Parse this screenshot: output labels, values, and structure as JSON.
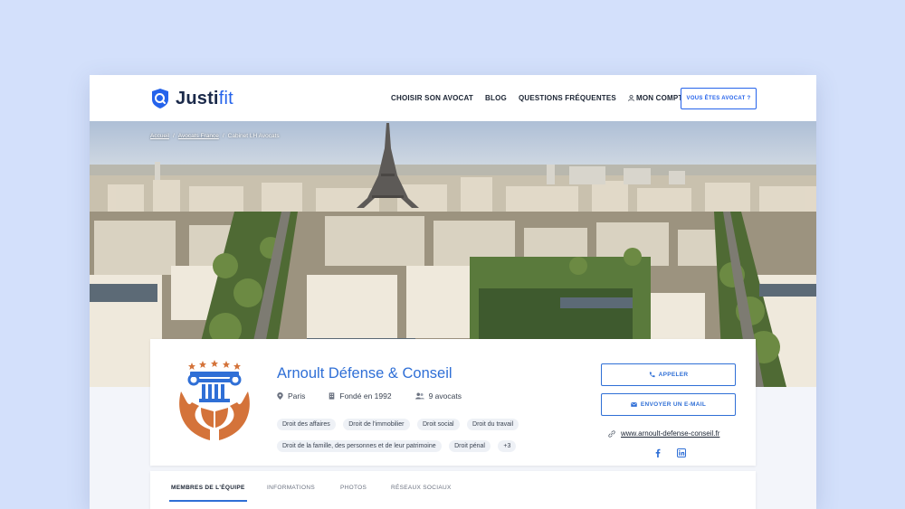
{
  "brand": {
    "name_dark": "Justi",
    "name_light": "fit"
  },
  "nav": {
    "items": [
      "CHOISIR SON AVOCAT",
      "BLOG",
      "QUESTIONS FRÉQUENTES",
      "MON COMPTE PRO"
    ],
    "cta": "VOUS ÊTES AVOCAT ?"
  },
  "breadcrumb": [
    "Accueil",
    "Avocats France",
    "Cabinet LH Avocats"
  ],
  "firm": {
    "name": "Arnoult Défense & Conseil",
    "city": "Paris",
    "founded": "Fondé en 1992",
    "lawyers": "9 avocats",
    "tags": [
      "Droit des affaires",
      "Droit de l'immobilier",
      "Droit social",
      "Droit du travail",
      "Droit de la famille, des personnes et de leur patrimoine",
      "Droit pénal",
      "+3"
    ],
    "call_label": "APPELER",
    "email_label": "ENVOYER UN E-MAIL",
    "website": "www.arnoult-defense-conseil.fr",
    "social": [
      "facebook-icon",
      "linkedin-icon"
    ]
  },
  "tabs": [
    "MEMBRES DE L'ÉQUIPE",
    "INFORMATIONS",
    "PHOTOS",
    "RÉSEAUX SOCIAUX"
  ],
  "colors": {
    "accent": "#2f6fd6",
    "logo_orange": "#d4733a",
    "logo_blue": "#2f6fd6"
  }
}
